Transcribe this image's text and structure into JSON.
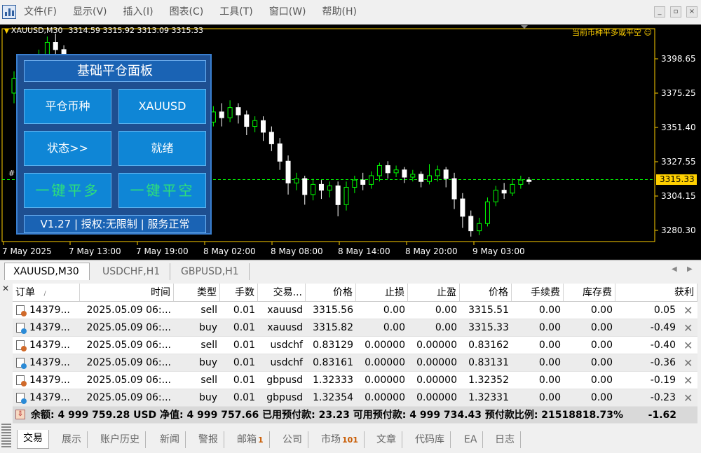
{
  "menu": {
    "items": [
      "文件(F)",
      "显示(V)",
      "插入(I)",
      "图表(C)",
      "工具(T)",
      "窗口(W)",
      "帮助(H)"
    ]
  },
  "chart": {
    "symbol_title": "XAUUSD,M30",
    "quotes": "3314.59 3315.92 3313.09 3315.33",
    "comment": "当前币种平多或平空 ☺",
    "price_ticks": [
      "3398.65",
      "3375.25",
      "3351.40",
      "3327.55",
      "3304.15",
      "3280.30"
    ],
    "current_price": "3315.33",
    "line_label": "#",
    "time_ticks": [
      "7 May 2025",
      "7 May 13:00",
      "7 May 19:00",
      "8 May 02:00",
      "8 May 08:00",
      "8 May 14:00",
      "8 May 20:00",
      "9 May 03:00"
    ],
    "colors": {
      "bull": "#00ff00",
      "bear": "#ffffff",
      "axis": "#ffd000",
      "background": "#000000"
    }
  },
  "panel": {
    "title": "基础平仓面板",
    "buttons": {
      "symbol_label": "平仓币种",
      "symbol_value": "XAUUSD",
      "status_label": "状态>>",
      "status_value": "就绪",
      "close_long": "一键平多",
      "close_short": "一键平空"
    },
    "footer": "V1.27 | 授权:无限制 | 服务正常"
  },
  "chart_tabs": [
    "XAUUSD,M30",
    "USDCHF,H1",
    "GBPUSD,H1"
  ],
  "terminal": {
    "columns": [
      "订单",
      "时间",
      "类型",
      "手数",
      "交易...",
      "价格",
      "止损",
      "止盈",
      "价格",
      "手续费",
      "库存费",
      "获利"
    ],
    "sort_indicator": "/",
    "orders": [
      {
        "ticket": "14379...",
        "time": "2025.05.09 06:...",
        "type": "sell",
        "lots": "0.01",
        "symbol": "xauusd",
        "open_price": "3315.56",
        "sl": "0.00",
        "tp": "0.00",
        "price": "3315.51",
        "commission": "0.00",
        "swap": "0.00",
        "profit": "0.05",
        "icon_color": "#d06a2a"
      },
      {
        "ticket": "14379...",
        "time": "2025.05.09 06:...",
        "type": "buy",
        "lots": "0.01",
        "symbol": "xauusd",
        "open_price": "3315.82",
        "sl": "0.00",
        "tp": "0.00",
        "price": "3315.33",
        "commission": "0.00",
        "swap": "0.00",
        "profit": "-0.49",
        "icon_color": "#2a8ad6"
      },
      {
        "ticket": "14379...",
        "time": "2025.05.09 06:...",
        "type": "sell",
        "lots": "0.01",
        "symbol": "usdchf",
        "open_price": "0.83129",
        "sl": "0.00000",
        "tp": "0.00000",
        "price": "0.83162",
        "commission": "0.00",
        "swap": "0.00",
        "profit": "-0.40",
        "icon_color": "#d06a2a"
      },
      {
        "ticket": "14379...",
        "time": "2025.05.09 06:...",
        "type": "buy",
        "lots": "0.01",
        "symbol": "usdchf",
        "open_price": "0.83161",
        "sl": "0.00000",
        "tp": "0.00000",
        "price": "0.83131",
        "commission": "0.00",
        "swap": "0.00",
        "profit": "-0.36",
        "icon_color": "#2a8ad6"
      },
      {
        "ticket": "14379...",
        "time": "2025.05.09 06:...",
        "type": "sell",
        "lots": "0.01",
        "symbol": "gbpusd",
        "open_price": "1.32333",
        "sl": "0.00000",
        "tp": "0.00000",
        "price": "1.32352",
        "commission": "0.00",
        "swap": "0.00",
        "profit": "-0.19",
        "icon_color": "#d06a2a"
      },
      {
        "ticket": "14379...",
        "time": "2025.05.09 06:...",
        "type": "buy",
        "lots": "0.01",
        "symbol": "gbpusd",
        "open_price": "1.32354",
        "sl": "0.00000",
        "tp": "0.00000",
        "price": "1.32331",
        "commission": "0.00",
        "swap": "0.00",
        "profit": "-0.23",
        "icon_color": "#2a8ad6"
      }
    ],
    "summary": {
      "text": "余额: 4 999 759.28 USD  净值: 4 999 757.66  已用预付款: 23.23  可用预付款: 4 999 734.43  预付款比例: 21518818.73%",
      "total_profit": "-1.62"
    }
  },
  "bottom_tabs": [
    {
      "label": "交易",
      "badge": ""
    },
    {
      "label": "展示",
      "badge": ""
    },
    {
      "label": "账户历史",
      "badge": ""
    },
    {
      "label": "新闻",
      "badge": ""
    },
    {
      "label": "警报",
      "badge": ""
    },
    {
      "label": "邮箱",
      "badge": "1"
    },
    {
      "label": "公司",
      "badge": ""
    },
    {
      "label": "市场",
      "badge": "101"
    },
    {
      "label": "文章",
      "badge": ""
    },
    {
      "label": "代码库",
      "badge": ""
    },
    {
      "label": "EA",
      "badge": ""
    },
    {
      "label": "日志",
      "badge": ""
    }
  ]
}
